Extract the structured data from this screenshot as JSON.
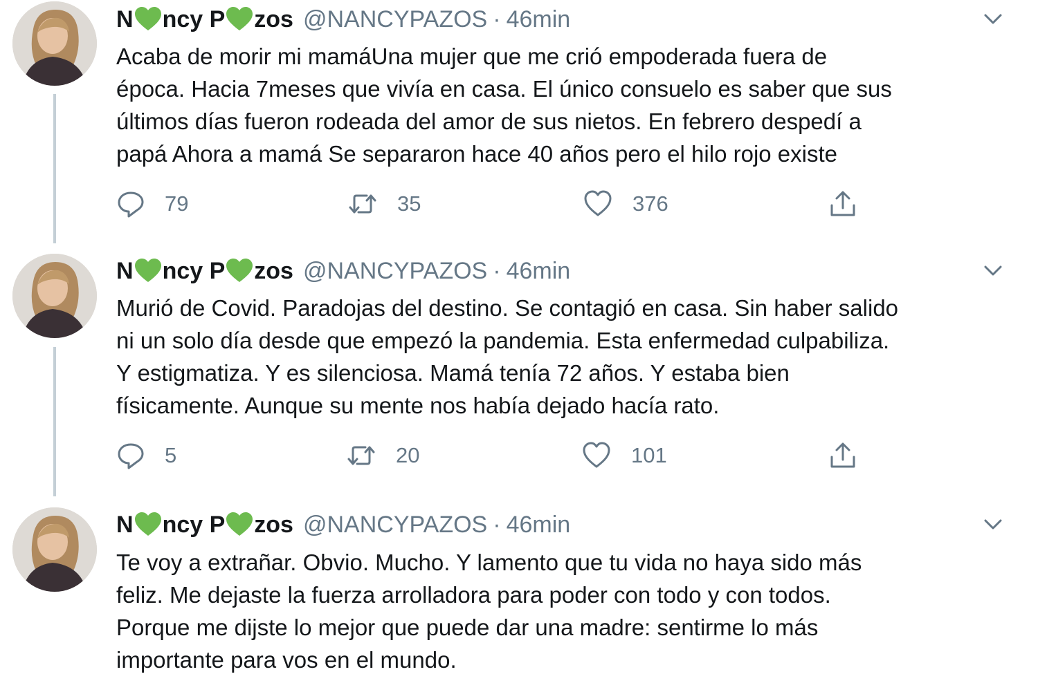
{
  "tweets": [
    {
      "name_part1": "N",
      "name_part2": "ncy P",
      "name_part3": "zos",
      "handle": "@NANCYPAZOS",
      "dot": "·",
      "time": "46min",
      "lines": [
        "Acaba de morir mi mamáUna mujer que me crió empoderada fuera de",
        "época. Hacia 7meses que vivía en casa.  El único consuelo es saber que sus",
        "últimos días fueron rodeada del amor de sus nietos. En febrero despedí a",
        "papá Ahora a mamá Se separaron hace 40 años pero el hilo rojo existe"
      ],
      "replies": "79",
      "retweets": "35",
      "likes": "376"
    },
    {
      "name_part1": "N",
      "name_part2": "ncy P",
      "name_part3": "zos",
      "handle": "@NANCYPAZOS",
      "dot": "·",
      "time": "46min",
      "lines": [
        "Murió de Covid. Paradojas del destino. Se contagió en casa. Sin haber salido",
        "ni un solo día desde que empezó la pandemia. Esta enfermedad culpabiliza.",
        "Y estigmatiza. Y es silenciosa. Mamá tenía 72 años. Y estaba bien",
        "físicamente. Aunque su mente nos había dejado hacía rato."
      ],
      "replies": "5",
      "retweets": "20",
      "likes": "101"
    },
    {
      "name_part1": "N",
      "name_part2": "ncy P",
      "name_part3": "zos",
      "handle": "@NANCYPAZOS",
      "dot": "·",
      "time": "46min",
      "lines": [
        "Te voy a extrañar. Obvio. Mucho. Y lamento que tu vida no haya sido más",
        "feliz. Me dejaste la fuerza arrolladora para poder con todo y con todos.",
        "Porque me dijste lo mejor que puede dar una madre: sentirme lo más",
        "importante para vos en el mundo."
      ]
    }
  ],
  "icons": {
    "reply": "reply-icon",
    "retweet": "retweet-icon",
    "like": "heart-icon",
    "share": "share-icon",
    "menu": "chevron-down-icon",
    "name_emoji": "green-heart-icon"
  },
  "colors": {
    "text": "#14171a",
    "secondary": "#657786",
    "thread_line": "#c4cfd6",
    "green_heart": "#6dbb4f"
  }
}
